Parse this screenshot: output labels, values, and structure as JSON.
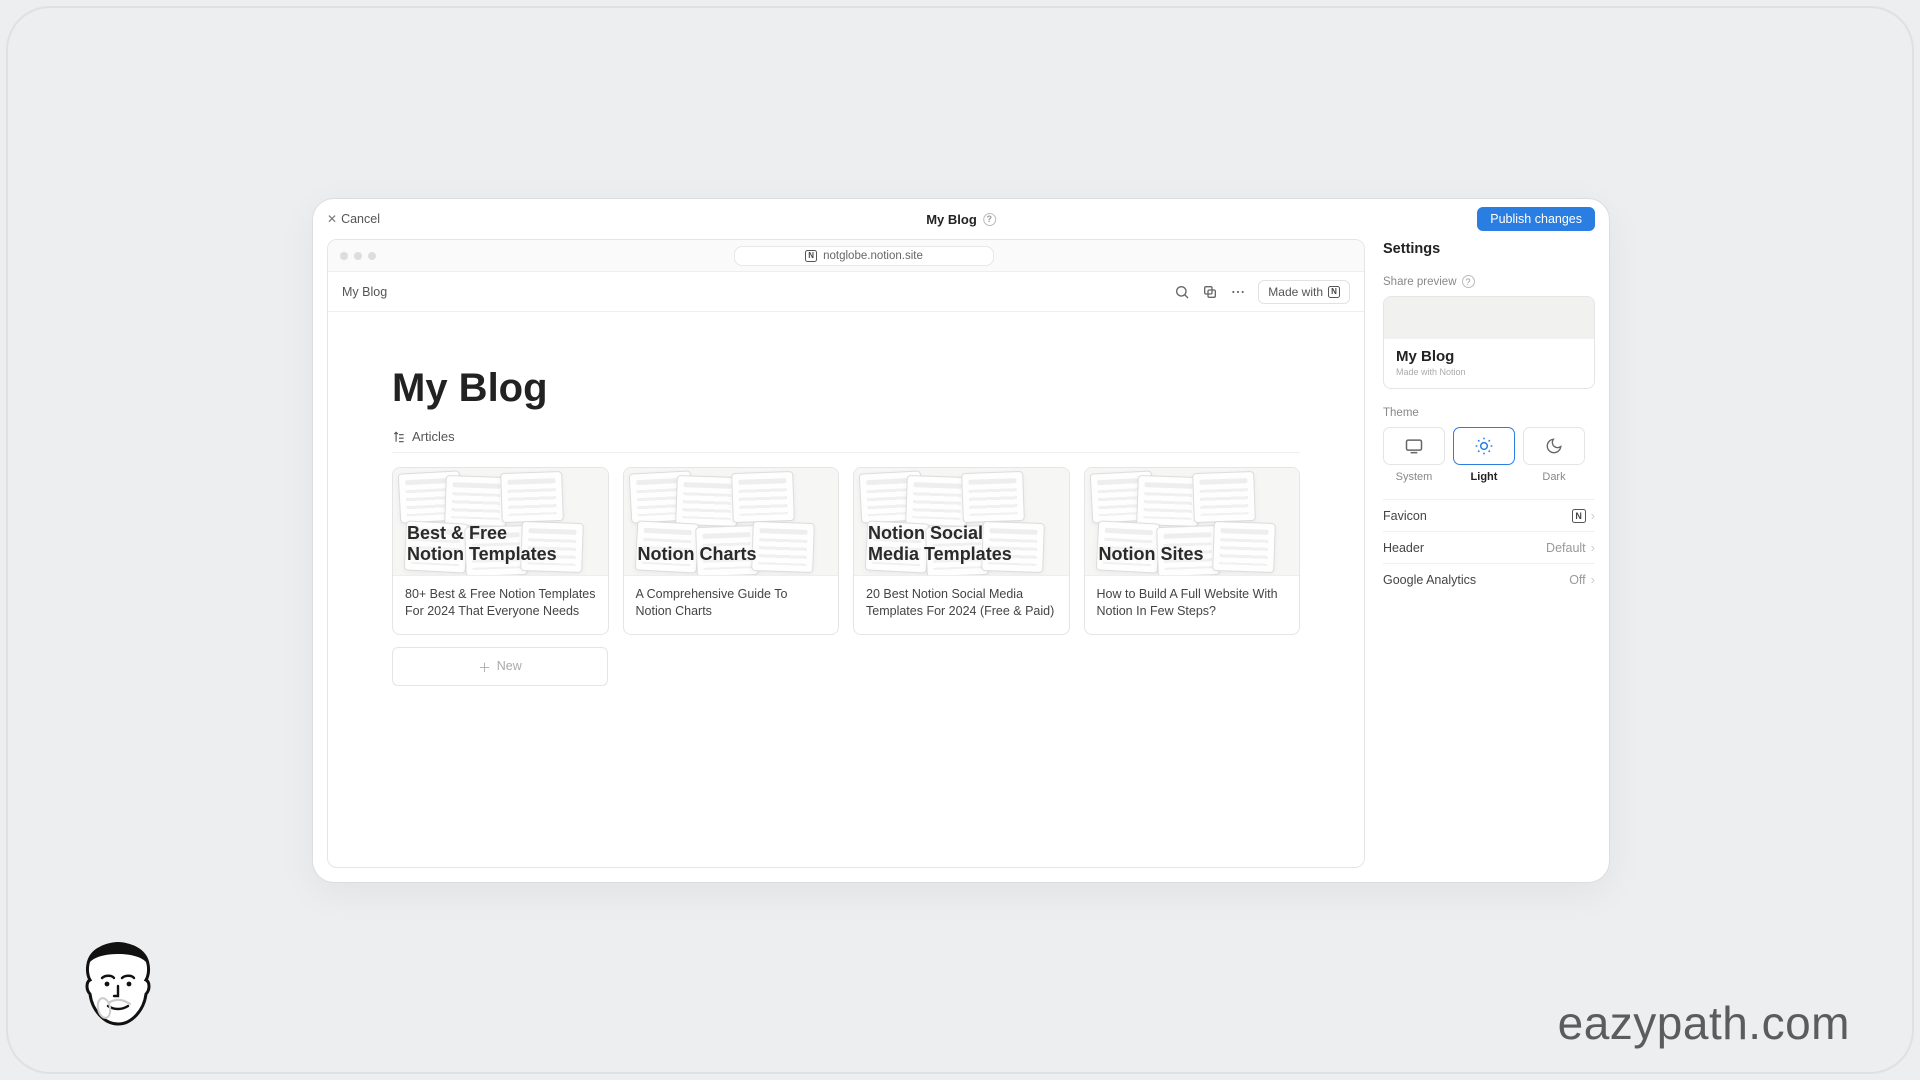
{
  "header": {
    "cancel": "Cancel",
    "title": "My Blog",
    "publish": "Publish changes"
  },
  "browser": {
    "url": "notglobe.notion.site"
  },
  "page": {
    "breadcrumb": "My Blog",
    "made_with": "Made with",
    "title": "My Blog",
    "tab": "Articles",
    "new_label": "New",
    "cards": [
      {
        "thumb_title": "Best & Free\nNotion Templates",
        "caption": "80+ Best & Free Notion Templates For 2024 That Everyone Needs"
      },
      {
        "thumb_title": "Notion Charts",
        "caption": "A Comprehensive Guide To Notion Charts"
      },
      {
        "thumb_title": "Notion Social\nMedia Templates",
        "caption": "20 Best Notion Social Media Templates For 2024 (Free & Paid)"
      },
      {
        "thumb_title": "Notion Sites",
        "caption": "How to Build A Full Website With Notion In Few Steps?"
      }
    ]
  },
  "settings": {
    "title": "Settings",
    "share_label": "Share preview",
    "share_title": "My Blog",
    "share_sub": "Made with Notion",
    "theme_label": "Theme",
    "themes": {
      "system": "System",
      "light": "Light",
      "dark": "Dark"
    },
    "selected_theme": "light",
    "rows": {
      "favicon": {
        "k": "Favicon",
        "v": ""
      },
      "header": {
        "k": "Header",
        "v": "Default"
      },
      "ga": {
        "k": "Google Analytics",
        "v": "Off"
      }
    }
  },
  "brand": "eazypath.com"
}
